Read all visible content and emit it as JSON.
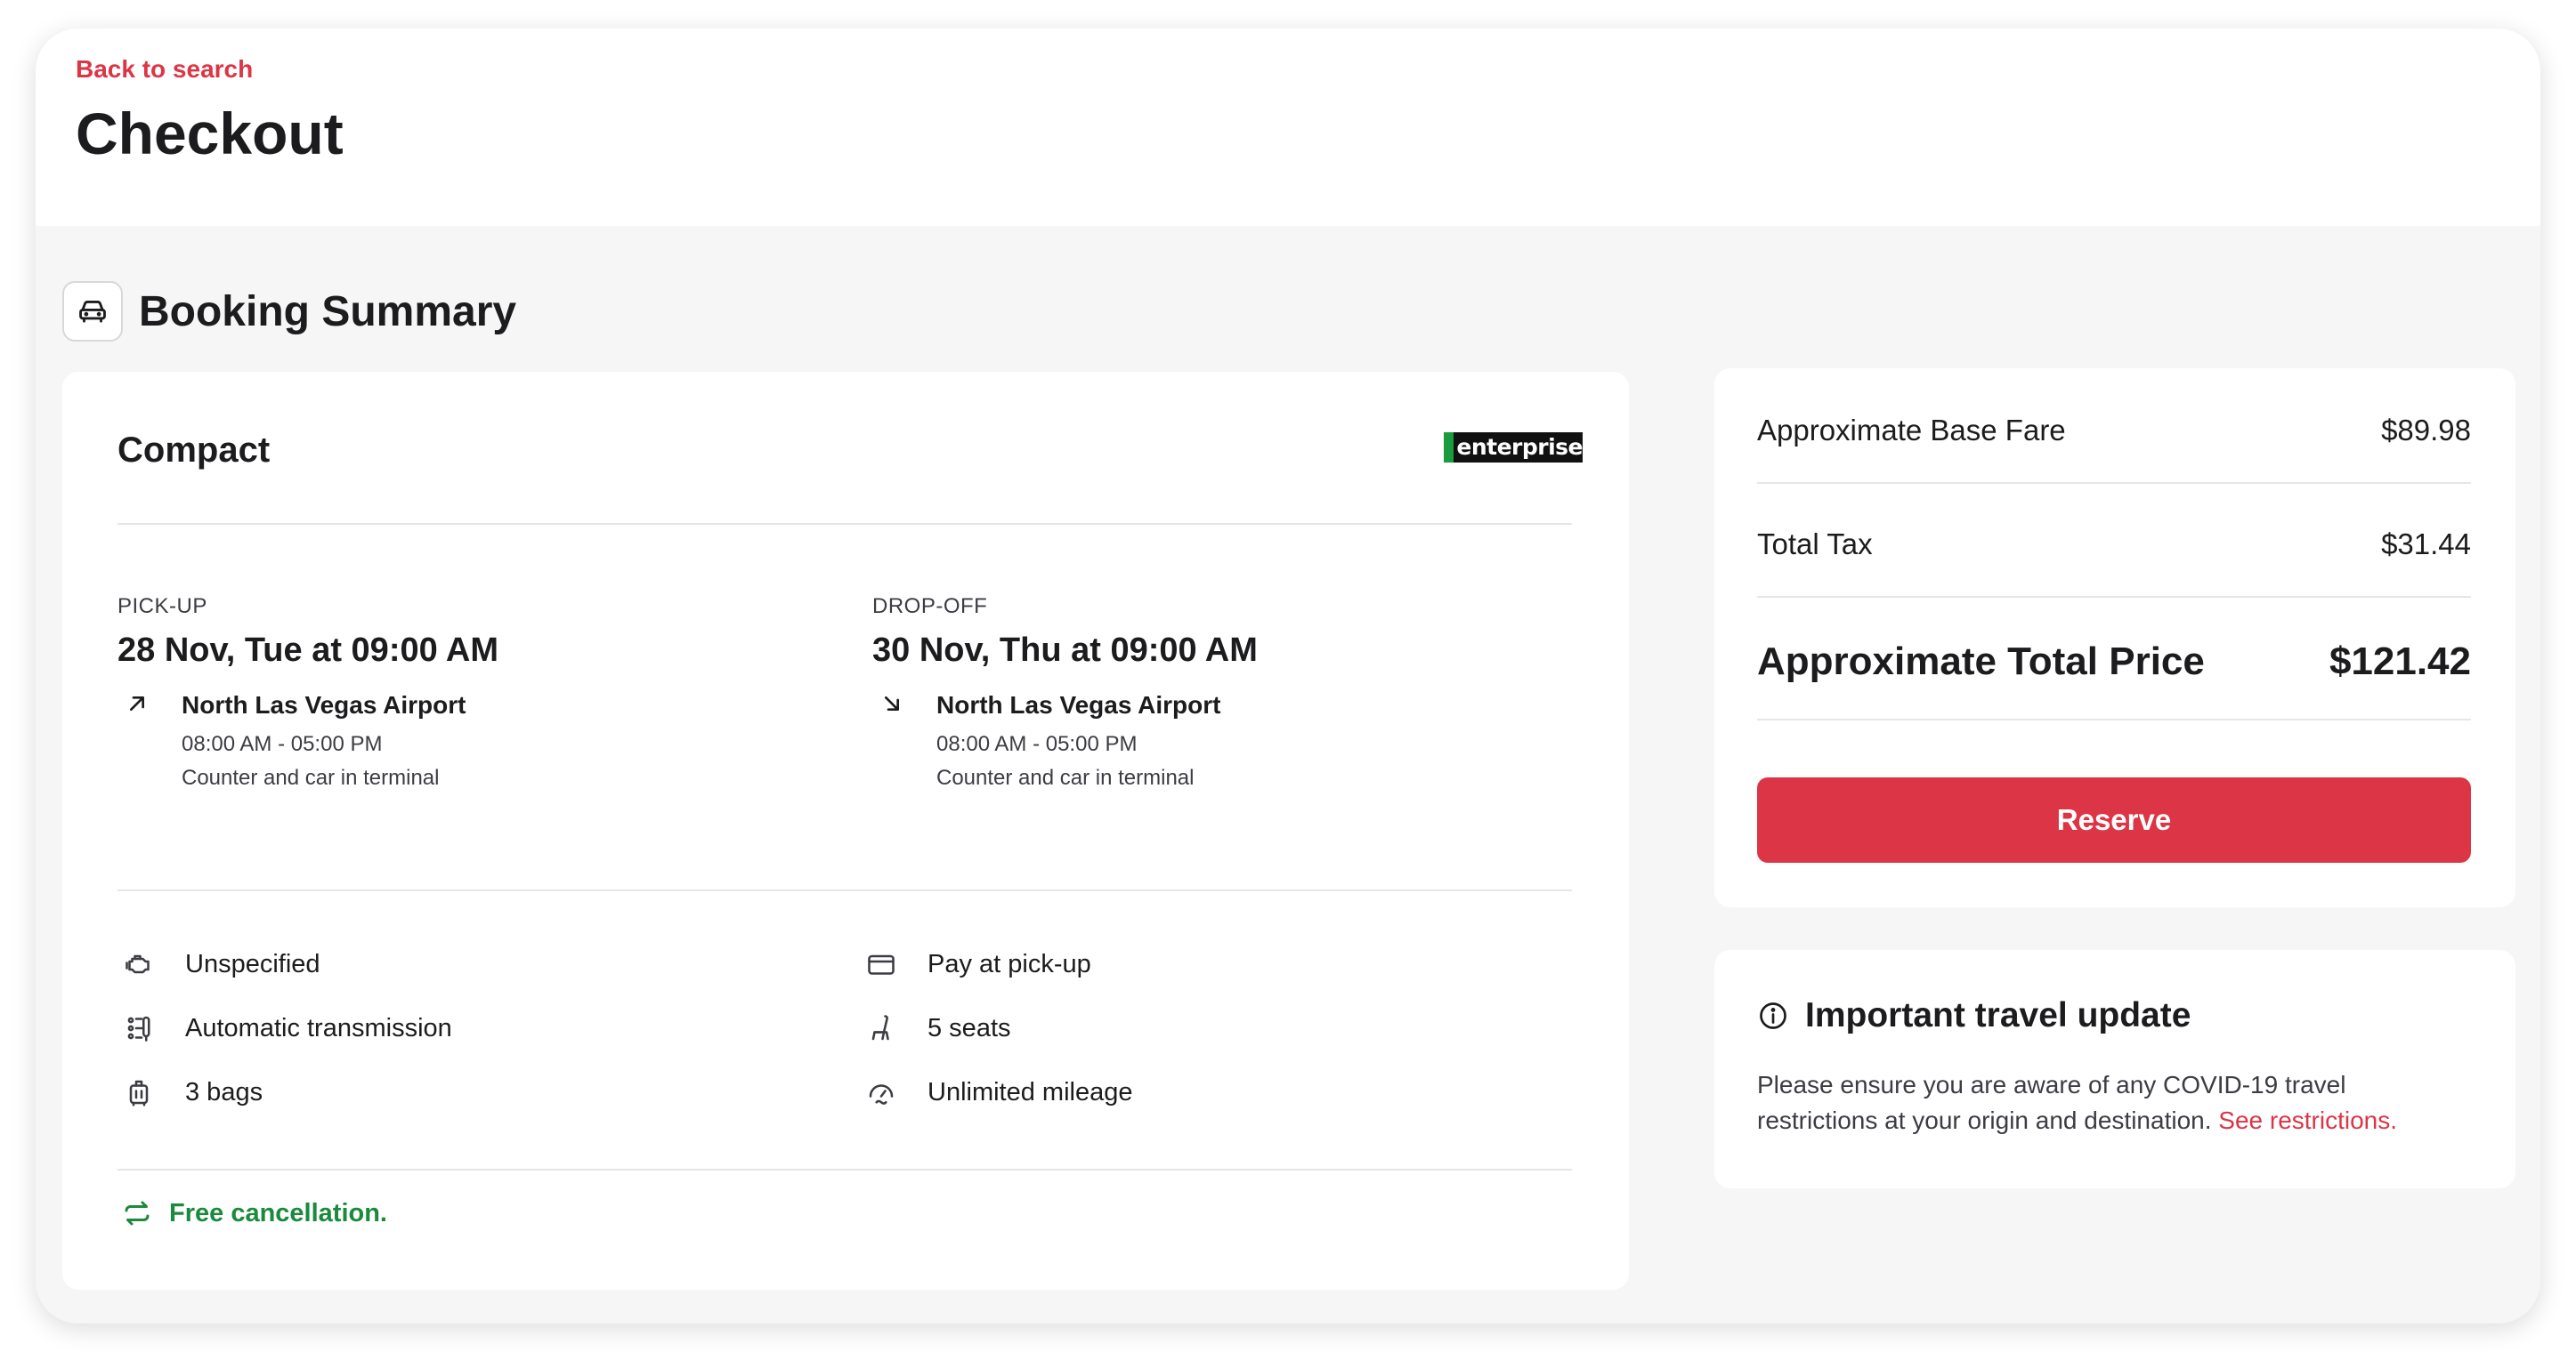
{
  "header": {
    "back_label": "Back to search",
    "title": "Checkout"
  },
  "section": {
    "title": "Booking Summary",
    "icon": "car-icon"
  },
  "summary": {
    "car_class": "Compact",
    "brand_logo_text": "enterprise",
    "pickup": {
      "label": "PICK-UP",
      "datetime": "28 Nov, Tue at 09:00 AM",
      "location": "North Las Vegas Airport",
      "hours": "08:00 AM - 05:00 PM",
      "note": "Counter and car in terminal"
    },
    "dropoff": {
      "label": "DROP-OFF",
      "datetime": "30 Nov, Thu at 09:00 AM",
      "location": "North Las Vegas Airport",
      "hours": "08:00 AM - 05:00 PM",
      "note": "Counter and car in terminal"
    },
    "features_left": [
      {
        "icon": "engine-icon",
        "label": "Unspecified"
      },
      {
        "icon": "gear-shift-icon",
        "label": "Automatic transmission"
      },
      {
        "icon": "luggage-icon",
        "label": "3 bags"
      }
    ],
    "features_right": [
      {
        "icon": "credit-card-icon",
        "label": "Pay at pick-up"
      },
      {
        "icon": "seat-icon",
        "label": "5 seats"
      },
      {
        "icon": "speedometer-icon",
        "label": "Unlimited mileage"
      }
    ],
    "cancellation": "Free cancellation."
  },
  "pricing": {
    "base_fare_label": "Approximate Base Fare",
    "base_fare_value": "$89.98",
    "tax_label": "Total Tax",
    "tax_value": "$31.44",
    "total_label": "Approximate Total Price",
    "total_value": "$121.42",
    "reserve_label": "Reserve"
  },
  "travel_update": {
    "title": "Important travel update",
    "body": "Please ensure you are aware of any COVID-19 travel restrictions at your origin and destination.",
    "link": "See restrictions."
  },
  "colors": {
    "accent": "#dc3545",
    "success": "#1a8a3c",
    "background": "#f6f6f7"
  }
}
